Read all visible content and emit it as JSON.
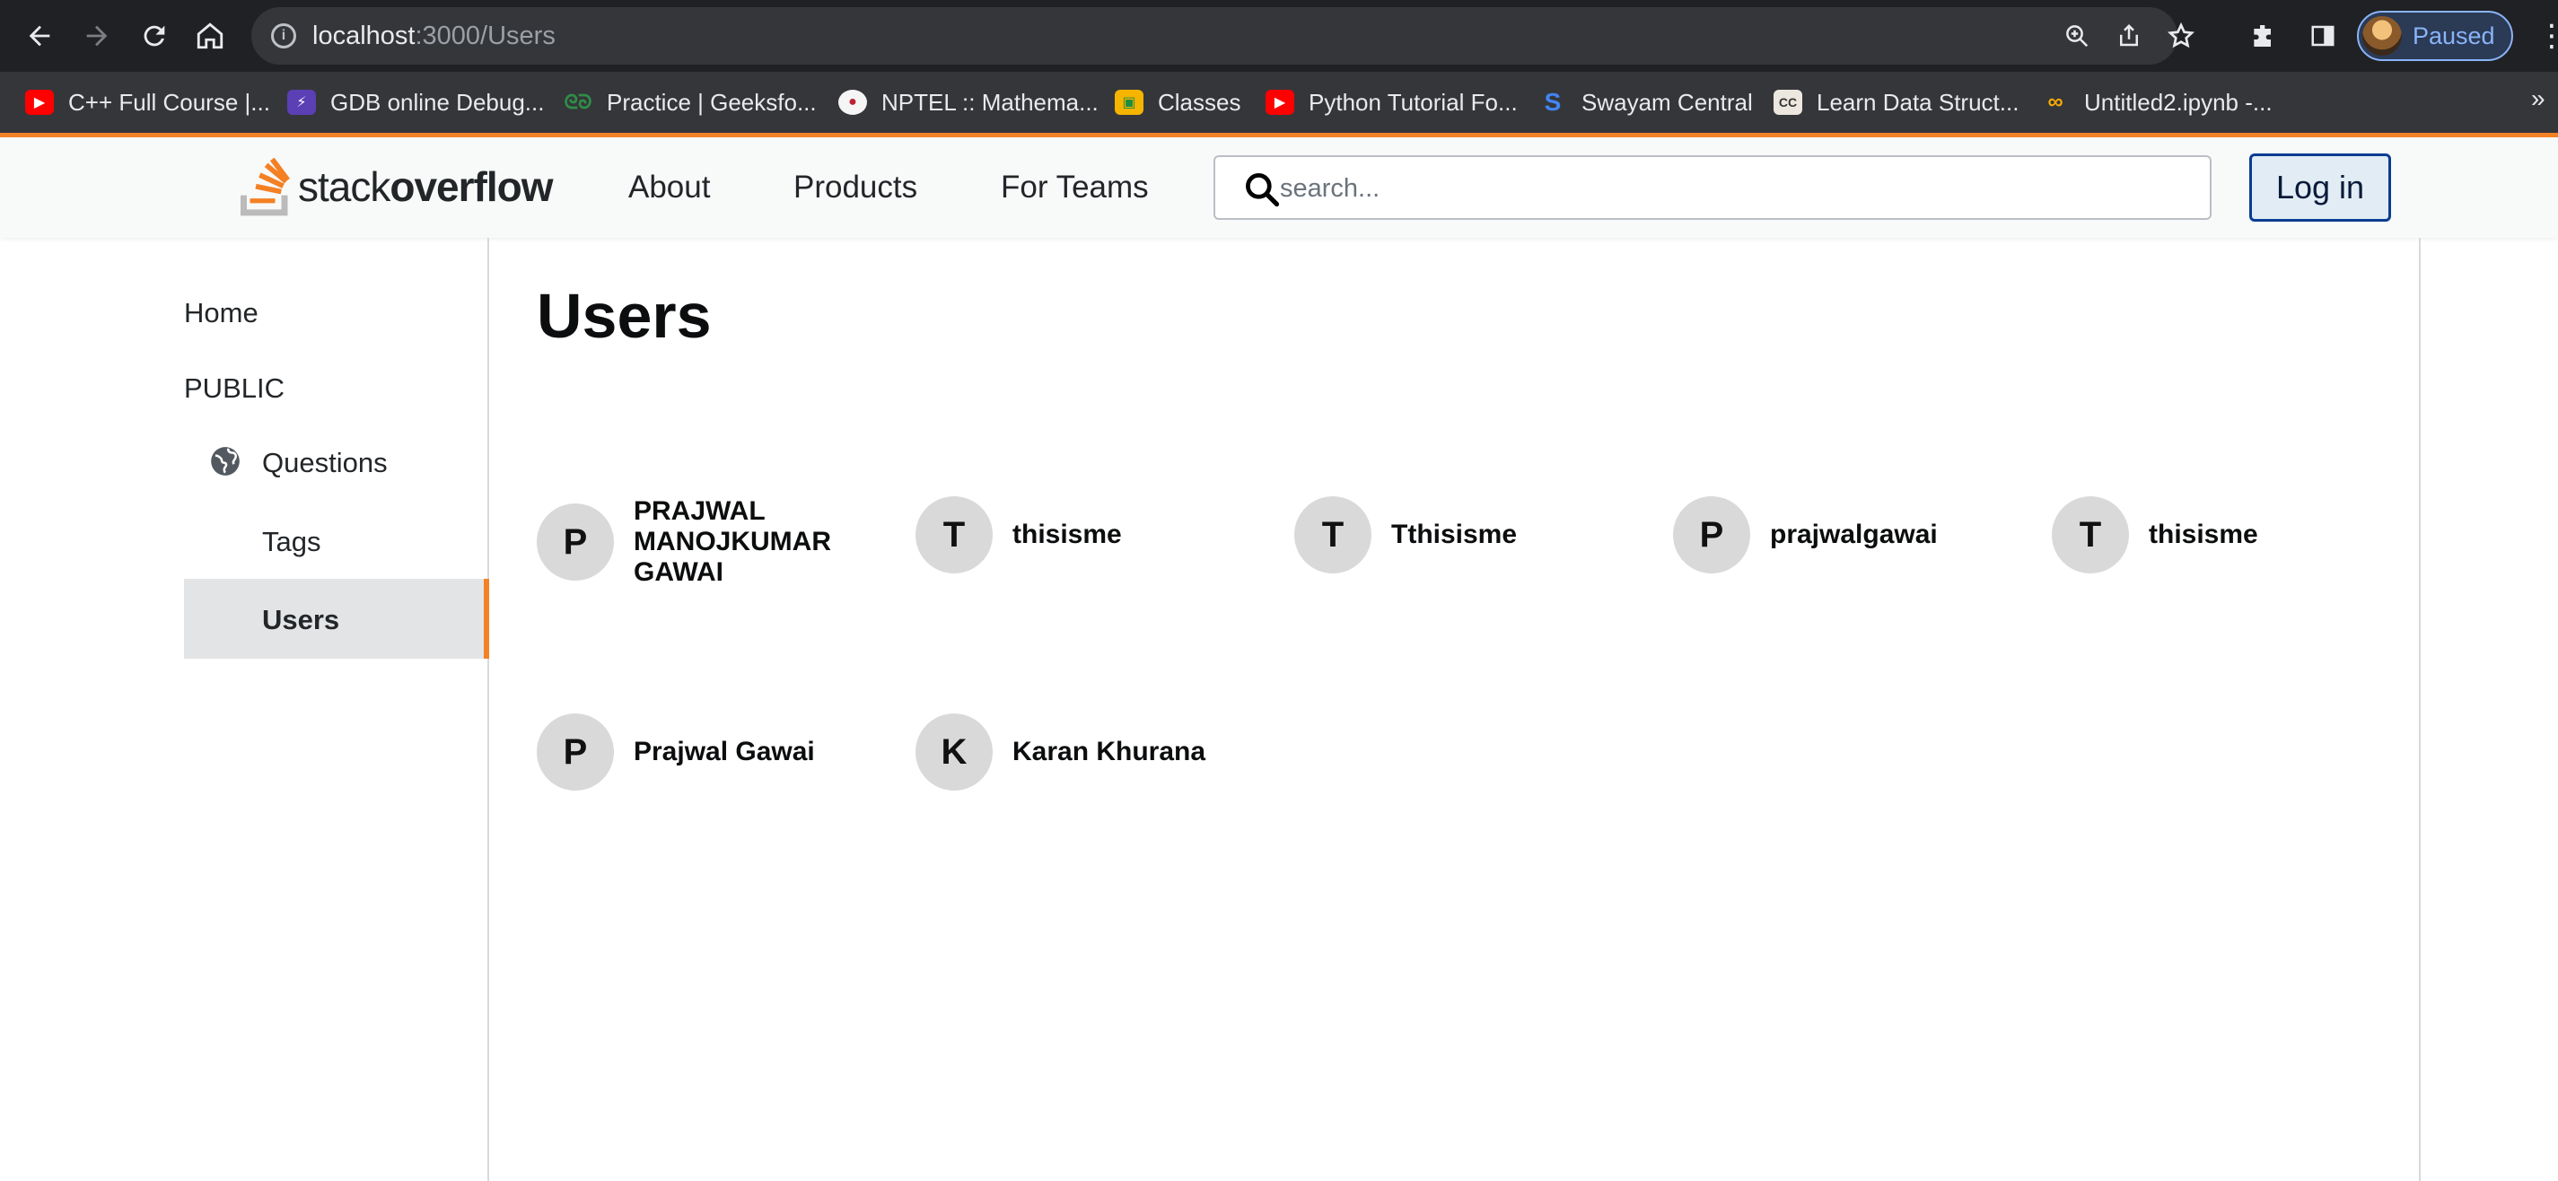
{
  "browser": {
    "url_host": "localhost",
    "url_path": ":3000/Users",
    "profile_label": "Paused",
    "bookmarks": [
      {
        "label": "C++ Full Course |...",
        "icon": "youtube-icon"
      },
      {
        "label": "GDB online Debug...",
        "icon": "gdb-icon"
      },
      {
        "label": "Practice | Geeksfo...",
        "icon": "geeksforgeeks-icon"
      },
      {
        "label": "NPTEL :: Mathema...",
        "icon": "nptel-icon"
      },
      {
        "label": "Classes",
        "icon": "classroom-icon"
      },
      {
        "label": "Python Tutorial Fo...",
        "icon": "youtube-icon"
      },
      {
        "label": "Swayam Central",
        "icon": "swayam-icon"
      },
      {
        "label": "Learn Data Struct...",
        "icon": "cc-icon"
      },
      {
        "label": "Untitled2.ipynb -...",
        "icon": "colab-icon"
      }
    ]
  },
  "header": {
    "logo_light": "stack",
    "logo_bold": "overflow",
    "nav": [
      "About",
      "Products",
      "For Teams"
    ],
    "search_placeholder": "search...",
    "login_label": "Log in"
  },
  "sidebar": {
    "home": "Home",
    "public": "PUBLIC",
    "questions": "Questions",
    "tags": "Tags",
    "users": "Users"
  },
  "main": {
    "title": "Users",
    "users": [
      {
        "initial": "P",
        "name": "PRAJWAL MANOJKUMAR GAWAI"
      },
      {
        "initial": "T",
        "name": "thisisme"
      },
      {
        "initial": "T",
        "name": "Tthisisme"
      },
      {
        "initial": "P",
        "name": "prajwalgawai"
      },
      {
        "initial": "T",
        "name": "thisisme"
      },
      {
        "initial": "P",
        "name": "Prajwal Gawai"
      },
      {
        "initial": "K",
        "name": "Karan Khurana"
      }
    ]
  },
  "colors": {
    "accent": "#f48225",
    "chrome_bg": "#202124",
    "avatar_bg": "#d9d9d9",
    "active_nav_bg": "#e3e4e5"
  }
}
